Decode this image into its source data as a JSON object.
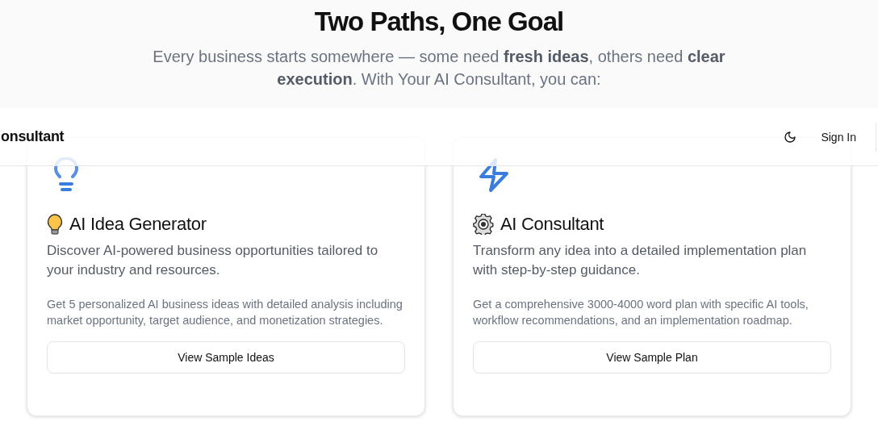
{
  "hero": {
    "title": "Two Paths, One Goal",
    "subtitle": "Every business starts somewhere — some need **fresh ideas**, others need **clear execution**. With Your AI Consultant, you can:"
  },
  "navbar": {
    "brand": "onsultant",
    "theme_toggle": {
      "dark": false
    },
    "sign_in": "Sign In"
  },
  "cards": [
    {
      "kind": "idea",
      "title": "AI Idea Generator",
      "description": "Discover AI-powered business opportunities tailored to your industry and resources.",
      "details": "Get 5 personalized AI business ideas with detailed analysis including market opportunity, target audience, and monetization strategies.",
      "button": "View Sample Ideas"
    },
    {
      "kind": "consultant",
      "title": "AI Consultant",
      "description": "Transform any idea into a detailed implementation plan with step-by-step guidance.",
      "details": "Get a comprehensive 3000-4000 word plan with specific AI tools, workflow recommendations, and an implementation roadmap.",
      "button": "View Sample Plan"
    }
  ]
}
